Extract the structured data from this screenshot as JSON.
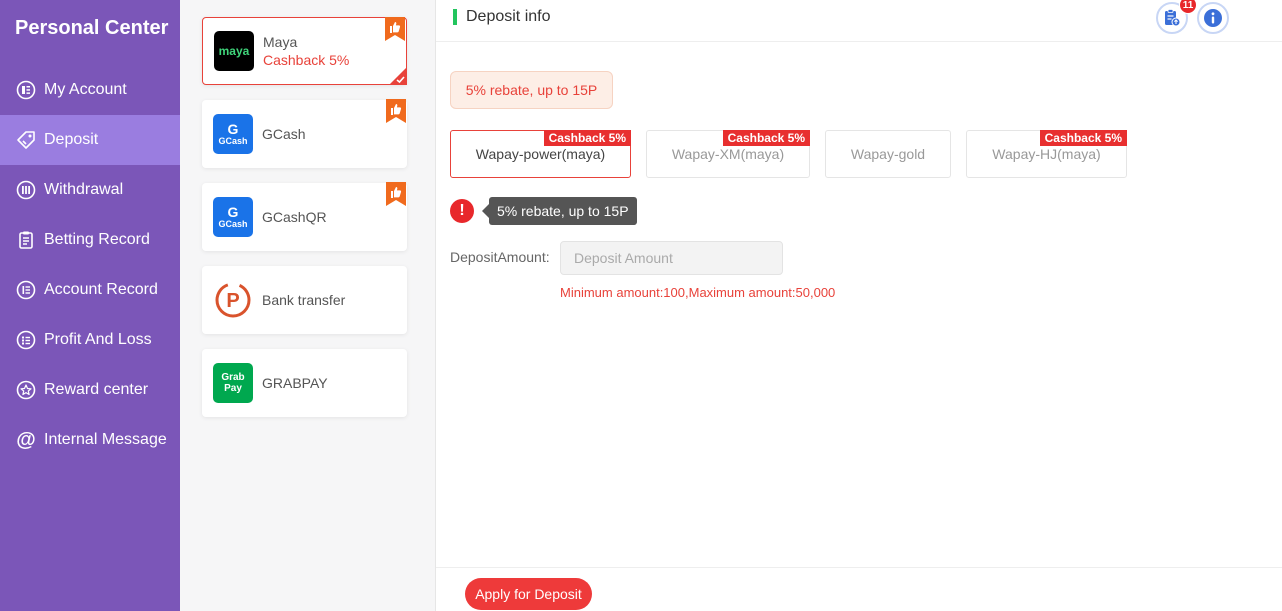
{
  "sidebar": {
    "title": "Personal Center",
    "items": [
      {
        "label": "My Account"
      },
      {
        "label": "Deposit"
      },
      {
        "label": "Withdrawal"
      },
      {
        "label": "Betting Record"
      },
      {
        "label": "Account Record"
      },
      {
        "label": "Profit And Loss"
      },
      {
        "label": "Reward center"
      },
      {
        "label": "Internal Message"
      }
    ],
    "active_index": 1
  },
  "channels": [
    {
      "name": "Maya",
      "cashback": "Cashback 5%",
      "logo_text": "maya",
      "selected": true
    },
    {
      "name": "GCash",
      "logo_text": "GCash"
    },
    {
      "name": "GCashQR",
      "logo_text": "GCash"
    },
    {
      "name": "Bank transfer"
    },
    {
      "name": "GRABPAY",
      "logo_text": "Grab Pay"
    }
  ],
  "header": {
    "title": "Deposit info",
    "badge_count": "11"
  },
  "rebate_text": "5% rebate, up to 15P",
  "methods": [
    {
      "label": "Wapay-power(maya)",
      "tag": "Cashback 5%",
      "selected": true
    },
    {
      "label": "Wapay-XM(maya)",
      "tag": "Cashback 5%"
    },
    {
      "label": "Wapay-gold"
    },
    {
      "label": "Wapay-HJ(maya)",
      "tag": "Cashback 5%"
    }
  ],
  "tooltip_text": "5% rebate, up to 15P",
  "amount": {
    "label": "DepositAmount:",
    "placeholder": "Deposit Amount",
    "hint": "Minimum amount:100,Maximum amount:50,000"
  },
  "apply_label": "Apply for Deposit",
  "colors": {
    "sidebar_bg": "#7b56b8",
    "sidebar_active": "#9a7de0",
    "accent_red": "#e8423a",
    "header_bar": "#23c55e"
  }
}
